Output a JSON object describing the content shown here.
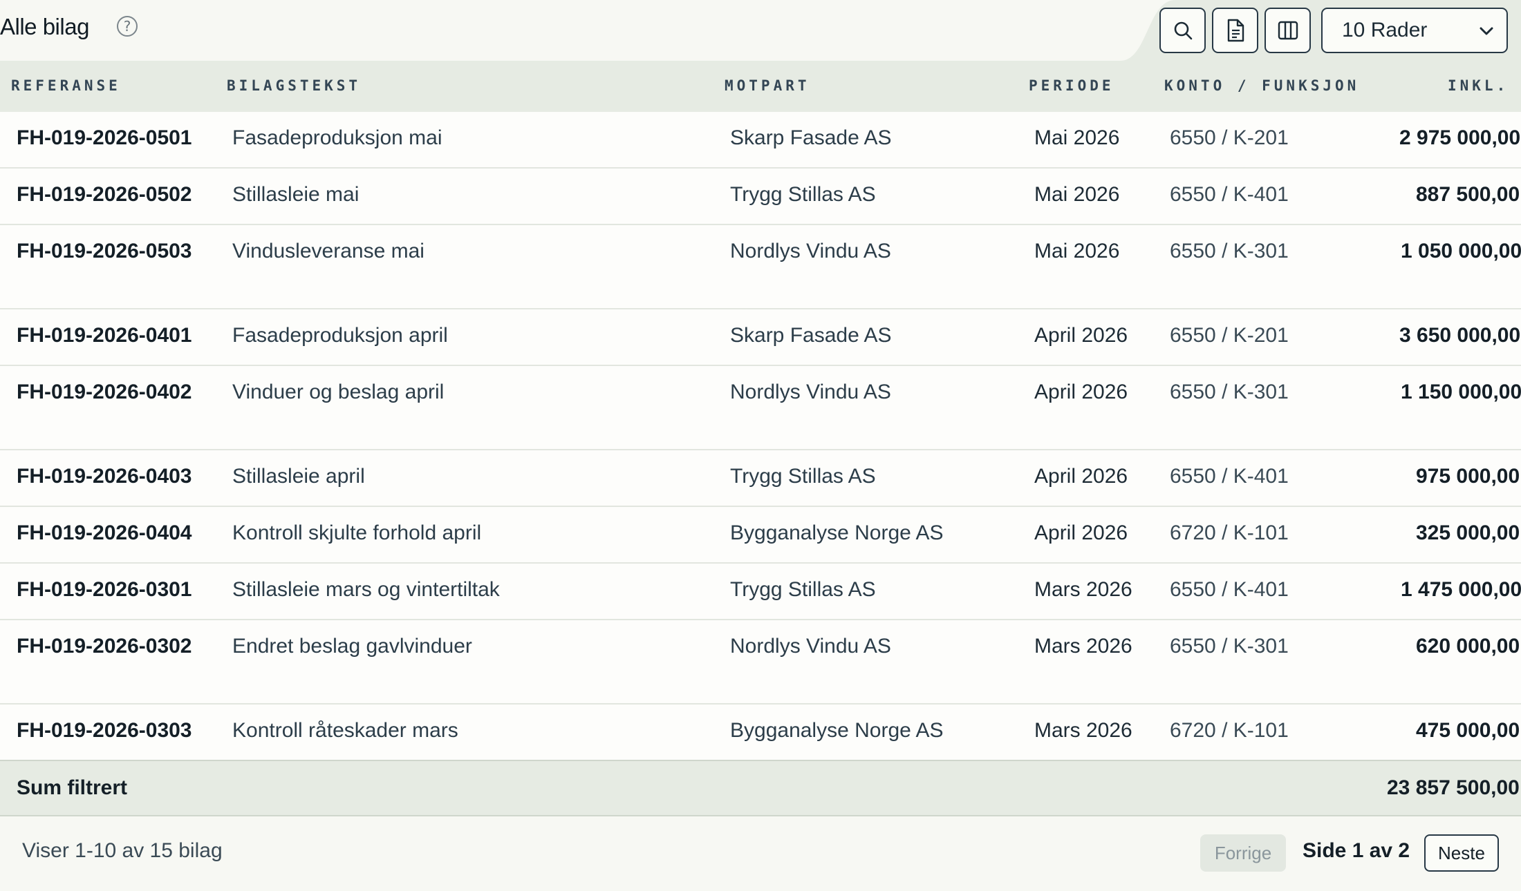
{
  "header": {
    "title": "Alle bilag",
    "help_symbol": "?",
    "rows_selected": "10 Rader",
    "icons": [
      "search-icon",
      "document-icon",
      "columns-icon",
      "chevron-down-icon"
    ]
  },
  "columns": [
    "REFERANSE",
    "BILAGSTEKST",
    "MOTPART",
    "PERIODE",
    "KONTO / FUNKSJON",
    "INKL. MVA"
  ],
  "rows": [
    {
      "ref": "FH-019-2026-0501",
      "text": "Fasadeproduksjon mai",
      "counterparty": "Skarp Fasade AS",
      "period": "Mai 2026",
      "account": "6550 / K-201",
      "amount": "2 975 000,00"
    },
    {
      "ref": "FH-019-2026-0502",
      "text": "Stillasleie mai",
      "counterparty": "Trygg Stillas AS",
      "period": "Mai 2026",
      "account": "6550 / K-401",
      "amount": "887 500,00"
    },
    {
      "ref": "FH-019-2026-0503",
      "text": "Vindusleveranse mai",
      "counterparty": "Nordlys Vindu AS",
      "period": "Mai 2026",
      "account": "6550 / K-301",
      "amount": "1 050 000,00"
    },
    {
      "ref": "FH-019-2026-0401",
      "text": "Fasadeproduksjon april",
      "counterparty": "Skarp Fasade AS",
      "period": "April 2026",
      "account": "6550 / K-201",
      "amount": "3 650 000,00"
    },
    {
      "ref": "FH-019-2026-0402",
      "text": "Vinduer og beslag april",
      "counterparty": "Nordlys Vindu AS",
      "period": "April 2026",
      "account": "6550 / K-301",
      "amount": "1 150 000,00"
    },
    {
      "ref": "FH-019-2026-0403",
      "text": "Stillasleie april",
      "counterparty": "Trygg Stillas AS",
      "period": "April 2026",
      "account": "6550 / K-401",
      "amount": "975 000,00"
    },
    {
      "ref": "FH-019-2026-0404",
      "text": "Kontroll skjulte forhold april",
      "counterparty": "Bygganalyse Norge AS",
      "period": "April 2026",
      "account": "6720 / K-101",
      "amount": "325 000,00"
    },
    {
      "ref": "FH-019-2026-0301",
      "text": "Stillasleie mars og vintertiltak",
      "counterparty": "Trygg Stillas AS",
      "period": "Mars 2026",
      "account": "6550 / K-401",
      "amount": "1 475 000,00"
    },
    {
      "ref": "FH-019-2026-0302",
      "text": "Endret beslag gavlvinduer",
      "counterparty": "Nordlys Vindu AS",
      "period": "Mars 2026",
      "account": "6550 / K-301",
      "amount": "620 000,00"
    },
    {
      "ref": "FH-019-2026-0303",
      "text": "Kontroll råteskader mars",
      "counterparty": "Bygganalyse Norge AS",
      "period": "Mars 2026",
      "account": "6720 / K-101",
      "amount": "475 000,00"
    }
  ],
  "sum": {
    "label": "Sum filtrert",
    "amount": "23 857 500,00"
  },
  "footer": {
    "showing": "Viser 1-10 av 15 bilag",
    "prev": "Forrige",
    "page": "Side 1 av 2",
    "next": "Neste"
  }
}
